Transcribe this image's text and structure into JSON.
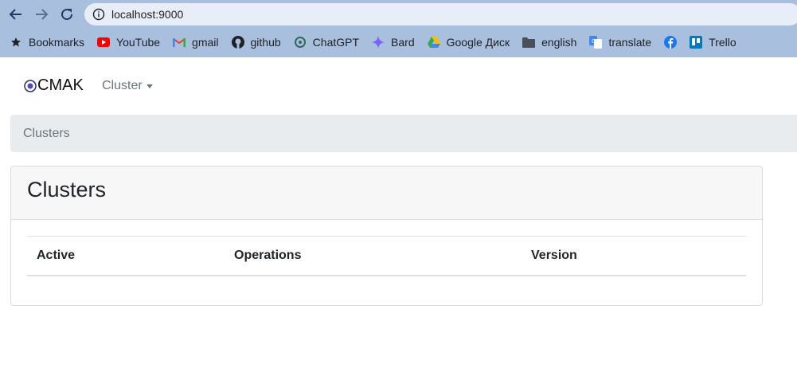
{
  "browser": {
    "url": "localhost:9000",
    "bookmarks": [
      {
        "icon": "star-icon",
        "label": "Bookmarks"
      },
      {
        "icon": "youtube-icon",
        "label": "YouTube"
      },
      {
        "icon": "gmail-icon",
        "label": "gmail"
      },
      {
        "icon": "github-icon",
        "label": "github"
      },
      {
        "icon": "chatgpt-icon",
        "label": "ChatGPT"
      },
      {
        "icon": "bard-icon",
        "label": "Bard"
      },
      {
        "icon": "google-drive-icon",
        "label": "Google Диск"
      },
      {
        "icon": "folder-icon",
        "label": "english"
      },
      {
        "icon": "google-translate-icon",
        "label": "translate"
      },
      {
        "icon": "facebook-icon",
        "label": ""
      },
      {
        "icon": "trello-icon",
        "label": "Trello"
      }
    ]
  },
  "navbar": {
    "brand": "CMAK",
    "cluster_menu": "Cluster"
  },
  "breadcrumb": {
    "current": "Clusters"
  },
  "card": {
    "title": "Clusters",
    "columns": [
      "Active",
      "Operations",
      "Version"
    ]
  },
  "colors": {
    "chrome_bg": "#a9bfde",
    "breadcrumb_bg": "#e9ecef",
    "card_header_bg": "#f7f7f7"
  }
}
